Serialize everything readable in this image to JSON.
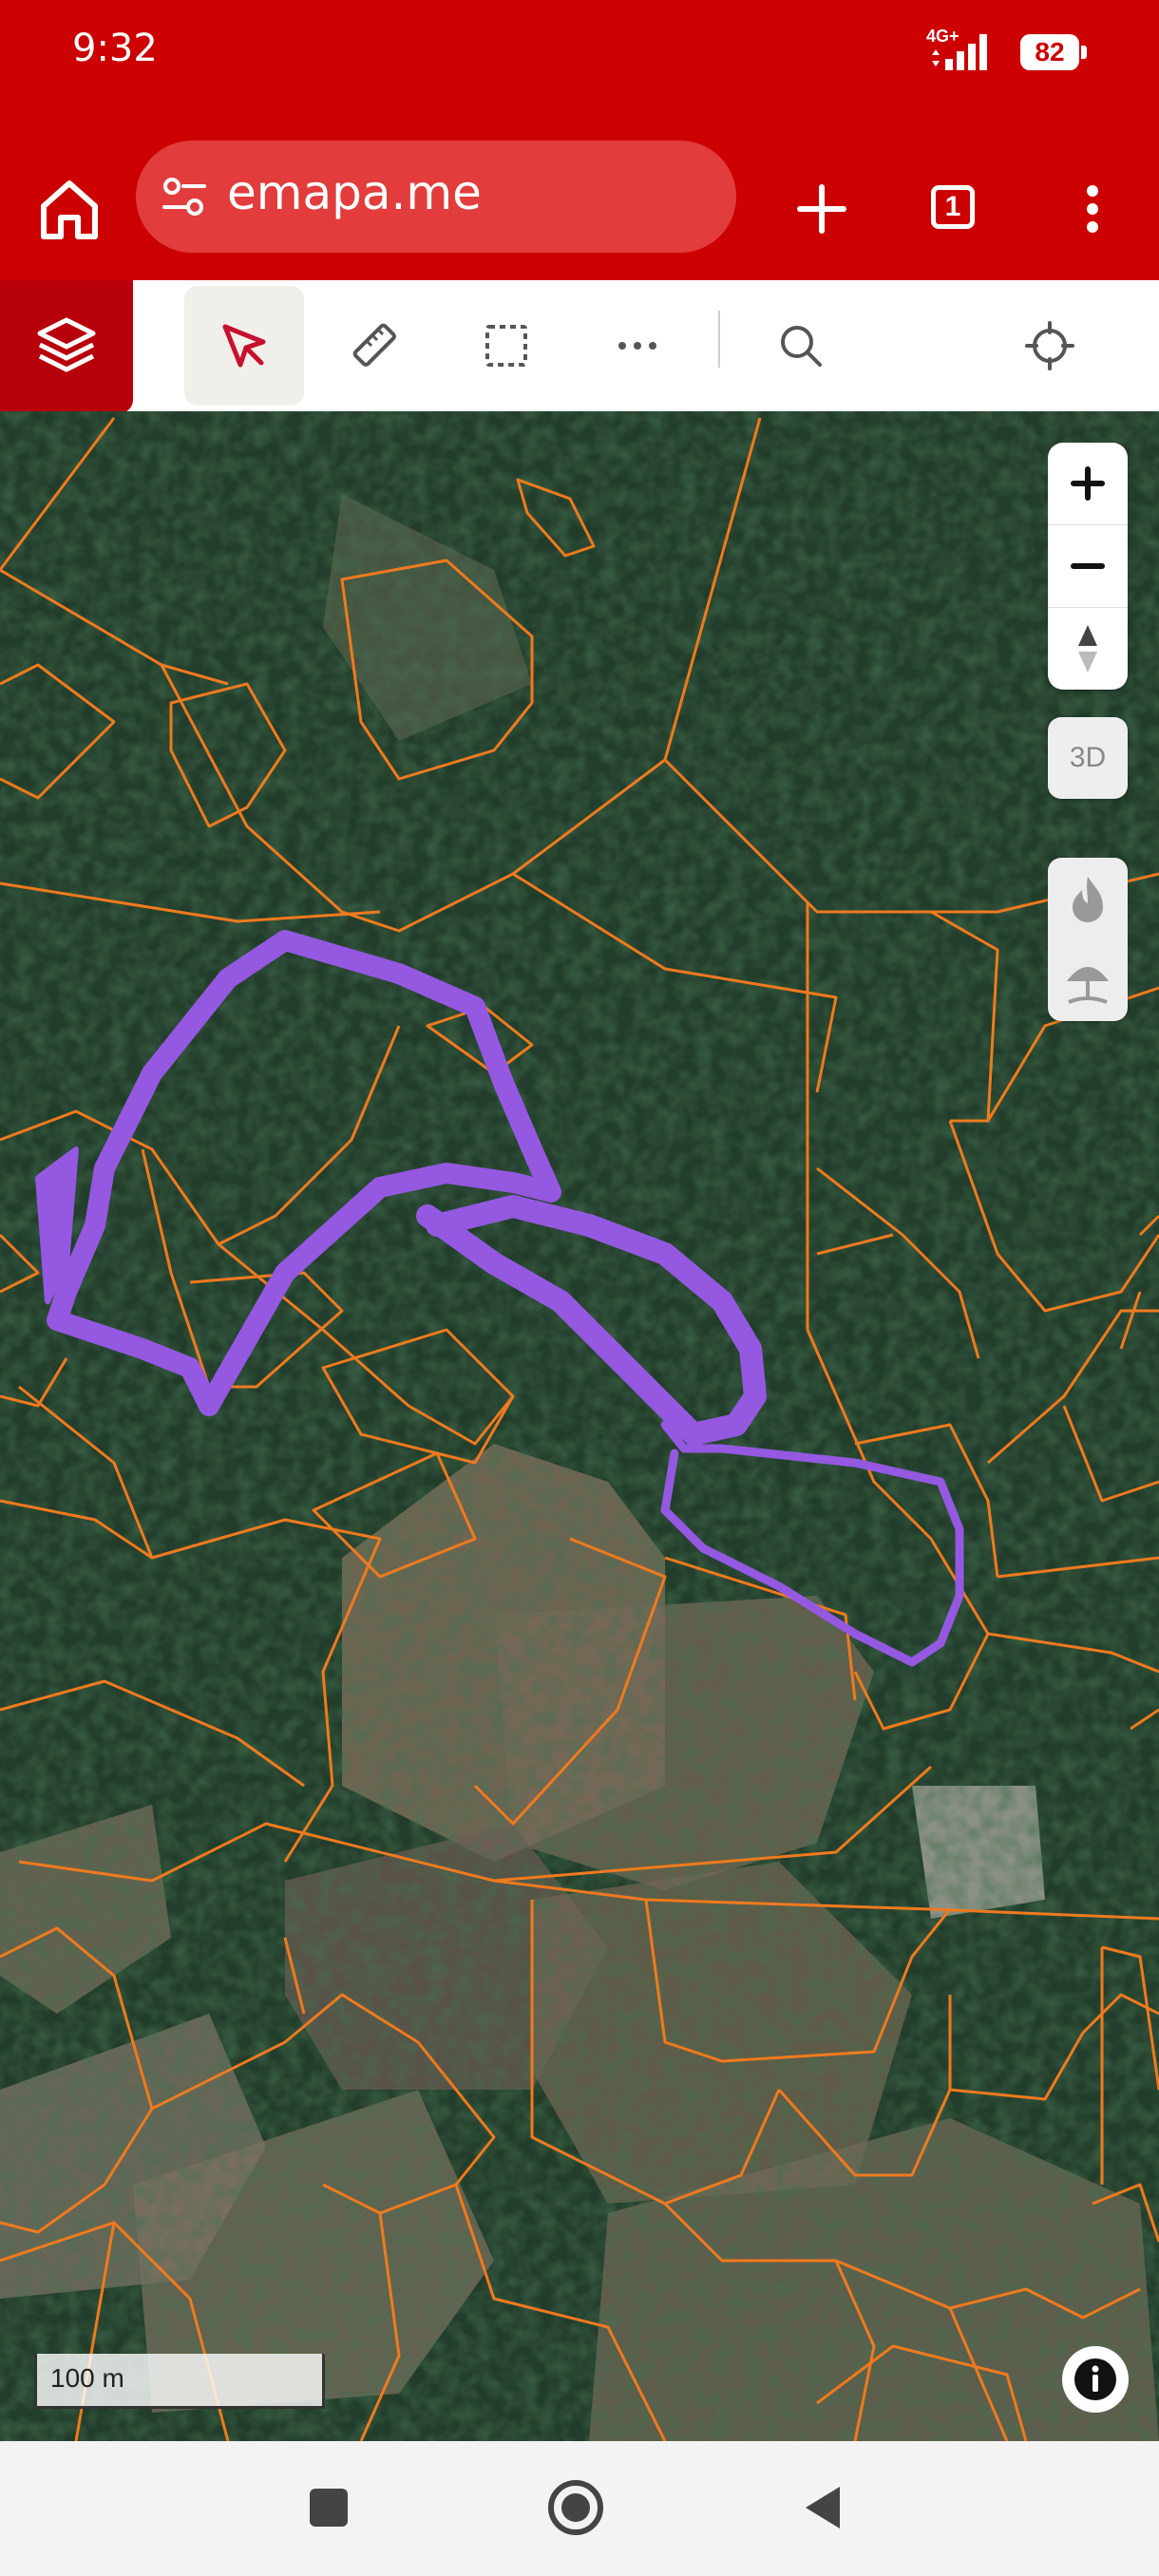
{
  "status_bar": {
    "time": "9:32",
    "network": "4G+",
    "battery": "82"
  },
  "browser": {
    "url": "emapa.me",
    "tab_count": "1"
  },
  "toolbar": {
    "tools": [
      "select-tool",
      "measure-tool",
      "area-select-tool",
      "more-tool",
      "search-tool",
      "locate-tool"
    ],
    "active_tool": "select-tool"
  },
  "map": {
    "parcel_color": "#f07a1e",
    "drawing_color": "#9459e0",
    "zoom_in_label": "+",
    "zoom_out_label": "−",
    "btn_3d_label": "3D",
    "scale_label": "100 m"
  },
  "colors": {
    "brand_red": "#cc0000",
    "layers_red": "#b8000c"
  }
}
